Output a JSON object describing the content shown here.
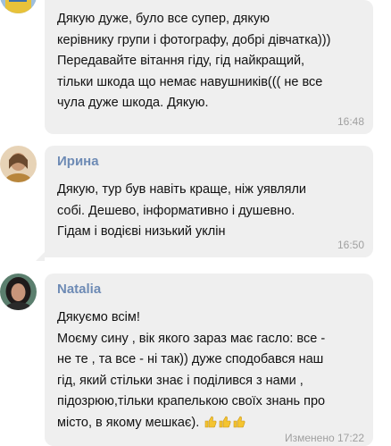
{
  "messages": [
    {
      "sender": "",
      "text": "Дякую дуже, було все супер, дякую\nкерівнику групи і фотографу, добрі дівчатка)))\nПередавайте вітання гіду, гід найкращий,\nтільки шкода що немає навушників((( не все\nчула дуже шкода. Дякую.",
      "time": "16:48"
    },
    {
      "sender": "Ирина",
      "text": "Дякую,  тур був навіть краще,  ніж уявляли\nсобі. Дешево, інформативно і душевно.\nГідам і водієві низький уклін",
      "time": "16:50"
    },
    {
      "sender": "Natalia",
      "text": "Дякуємо всім!\nМоєму сину , вік якого зараз має гасло: все -\nне те , та все - ні так)) дуже сподобався наш\nгід, який стільки знає і поділився з нами ,\nпідозрюю,тільки крапелькою своїх знань про\nмісто, в якому мешкає).",
      "emoji": "thumbs-up x3",
      "time": "Изменено 17:22"
    }
  ],
  "colors": {
    "bubble": "#efefef",
    "sender": "#6e8bb5",
    "time": "#a0a0a0",
    "text": "#111111"
  }
}
